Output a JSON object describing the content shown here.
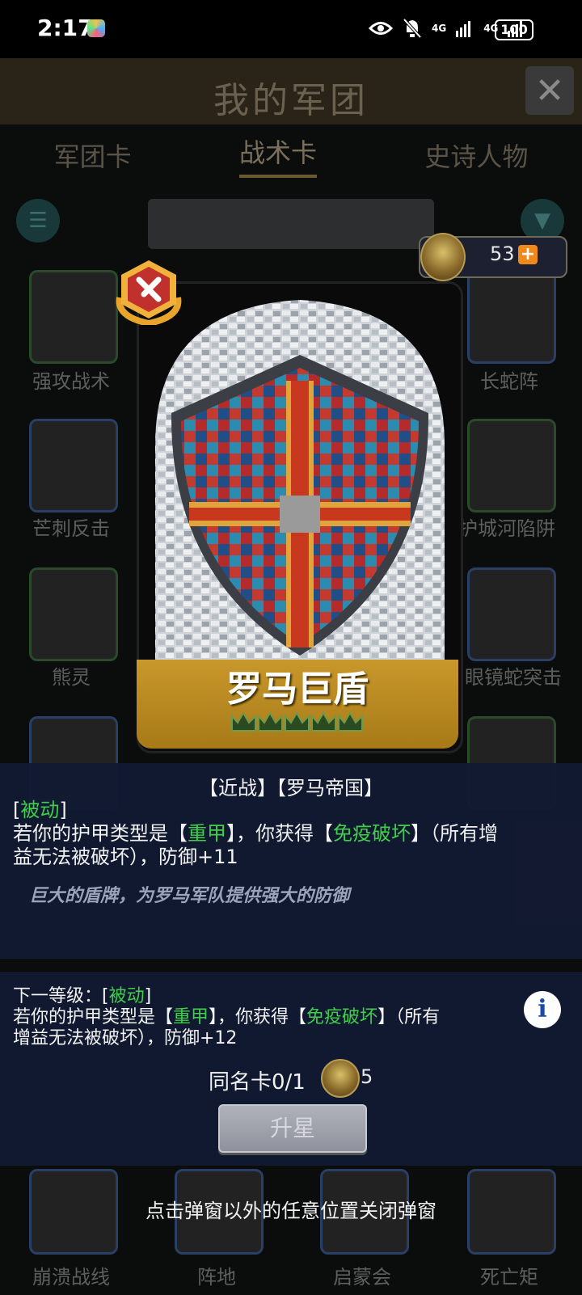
{
  "status_bar": {
    "time": "2:17",
    "battery": "100",
    "network_1": "4G",
    "network_2": "4G"
  },
  "background": {
    "title": "我的军团",
    "tabs": [
      "军团卡",
      "战术卡",
      "史诗人物"
    ],
    "cards_left": [
      "强攻战术",
      "芒刺反击",
      "熊灵"
    ],
    "cards_right": [
      "长蛇阵",
      "护城河陷阱",
      "眼镜蛇突击"
    ],
    "cards_bottom": [
      "崩溃战线",
      "阵地",
      "启蒙会",
      "死亡矩"
    ]
  },
  "currency": {
    "amount": "53",
    "plus": "+"
  },
  "card": {
    "name": "罗马巨盾",
    "stars": 5
  },
  "detail": {
    "tags": "【近战】【罗马帝国】",
    "type_label": "被动",
    "desc_pre": "若你的护甲类型是【",
    "armor": "重甲",
    "desc_mid": "】，你获得【",
    "effect": "免疫破坏",
    "desc_post": "】（所有增",
    "desc_line2": "益无法被破坏），防御+11",
    "flavor": "巨大的盾牌，为罗马军队提供强大的防御"
  },
  "next_level": {
    "label": "下一等级：",
    "type_label": "被动",
    "desc_pre": "若你的护甲类型是【",
    "armor": "重甲",
    "desc_mid": "】，你获得【",
    "effect": "免疫破坏",
    "desc_post": "】（所有",
    "desc_line2": "增益无法被破坏），防御+12",
    "info": "i"
  },
  "copies": {
    "label": "同名卡0/1",
    "cost": "5"
  },
  "upgrade_button": "升星",
  "hint": "点击弹窗以外的任意位置关闭弹窗"
}
